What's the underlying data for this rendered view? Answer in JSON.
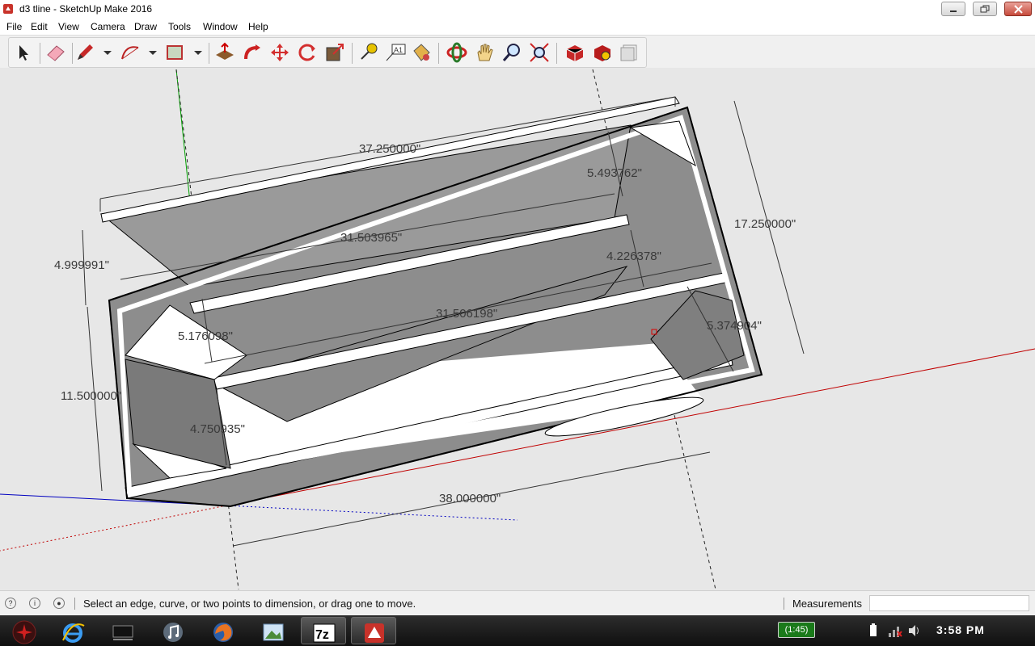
{
  "window": {
    "title": "d3 tline - SketchUp Make 2016"
  },
  "menu": [
    "File",
    "Edit",
    "View",
    "Camera",
    "Draw",
    "Tools",
    "Window",
    "Help"
  ],
  "toolbar": {
    "tools": [
      "select-tool-icon",
      "eraser-tool-icon",
      "pencil-tool-icon",
      "arc-tool-icon",
      "rectangle-tool-icon",
      "push-pull-icon",
      "follow-me-icon",
      "move-icon",
      "rotate-icon",
      "scale-icon",
      "tape-measure-icon",
      "text-tool-icon",
      "paint-bucket-icon",
      "orbit-icon",
      "pan-icon",
      "zoom-icon",
      "zoom-extents-icon",
      "warehouse-icon",
      "extension-warehouse-icon",
      "layout-icon"
    ]
  },
  "dimensions": [
    "37.250000\"",
    "5.493762\"",
    "17.250000\"",
    "31.503965\"",
    "4.999991\"",
    "4.226378\"",
    "31.506198\"",
    "5.374904\"",
    "5.176098\"",
    "11.500000\"",
    "4.750935\"",
    "38.000000\""
  ],
  "status": {
    "message": "Select an edge, curve, or two points to dimension, or drag one to move.",
    "measurements_label": "Measurements",
    "measurements_value": ""
  },
  "taskbar": {
    "battery": "(1:45)",
    "clock": "3:58 PM",
    "apps": [
      "start-orb",
      "internet-explorer-icon",
      "desktop-icon",
      "itunes-icon",
      "firefox-icon",
      "photo-viewer-icon",
      "7zip-icon",
      "sketchup-icon"
    ]
  },
  "colors": {
    "viewport_bg": "#e7e7e7",
    "face_gray": "#8f8f8f",
    "red_axis": "#c00000",
    "green_axis": "#00a000",
    "blue_axis": "#0000c0"
  }
}
